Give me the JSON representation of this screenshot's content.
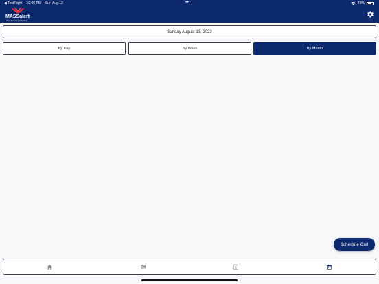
{
  "status_bar": {
    "carrier": "◀ TestFlight",
    "time": "10:06 PM",
    "date": "Sun Aug 13",
    "dots": "•••",
    "battery": "79%"
  },
  "brand": {
    "name": "MASSalert",
    "tagline": "Mass Alert Support System",
    "accent": "#0e2a6e",
    "logo_red": "#d8283a"
  },
  "icons": {
    "settings": "gear-icon",
    "wifi": "wifi-icon",
    "battery": "battery-icon"
  },
  "date_display": "Sunday August 13, 2023",
  "view_modes": [
    {
      "label": "By Day",
      "active": false
    },
    {
      "label": "By Week",
      "active": false
    },
    {
      "label": "By Month",
      "active": true
    }
  ],
  "fab_label": "Schedule Call",
  "tabs": [
    {
      "icon": "home-icon",
      "active": false
    },
    {
      "icon": "message-icon",
      "active": false
    },
    {
      "icon": "contacts-icon",
      "active": false
    },
    {
      "icon": "calendar-icon",
      "active": true
    }
  ],
  "colors": {
    "tab_active": "#1a2a5c",
    "tab_inactive": "#8a8d96"
  }
}
